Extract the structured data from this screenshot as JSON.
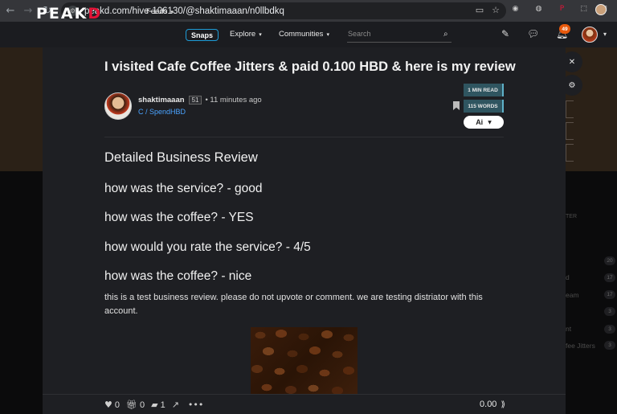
{
  "browser": {
    "url": "peakd.com/hive-106130/@shaktimaaan/n0llbdkq"
  },
  "header": {
    "logo_main": "PEAK",
    "logo_accent": "D",
    "menu": [
      {
        "label": "Feeds"
      },
      {
        "label": "Snaps"
      },
      {
        "label": "Explore"
      },
      {
        "label": "Communities"
      }
    ],
    "search_placeholder": "Search",
    "notification_count": "49"
  },
  "post": {
    "title": "I visited Cafe Coffee Jitters & paid 0.100 HBD & here is my review",
    "author": "shaktimaaan",
    "reputation": "51",
    "time": "• 11 minutes ago",
    "community": "C / SpendHBD",
    "read_time": "1 MIN READ",
    "word_count": "115 WORDS",
    "ai_label": "Ai",
    "headings": [
      "Detailed Business Review",
      "how was the service? - good",
      "how was the coffee? - YES",
      "how would you rate the service? - 4/5",
      "how was the coffee? - nice"
    ],
    "paragraph": "this is a test business review. please do not upvote or comment. we are testing distriator with this account."
  },
  "footer": {
    "votes": "0",
    "tips": "0",
    "comments": "1",
    "payout": "0.00"
  },
  "background": {
    "sidebar_heading_partial": "TER",
    "sidebar_items": [
      {
        "label": "d",
        "count": "17"
      },
      {
        "label": "eam",
        "count": "17"
      },
      {
        "label": "",
        "count": "3"
      },
      {
        "label": "nt",
        "count": "3"
      },
      {
        "label": "fee Jitters",
        "count": "3"
      }
    ],
    "top_count": "20"
  }
}
